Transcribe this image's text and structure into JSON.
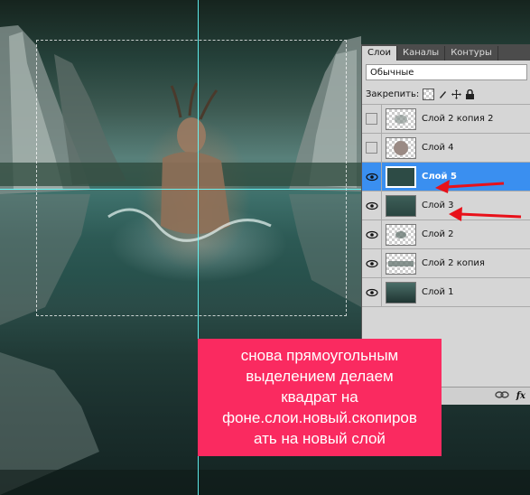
{
  "panel": {
    "tabs": [
      {
        "label": "Слои"
      },
      {
        "label": "Каналы"
      },
      {
        "label": "Контуры"
      }
    ],
    "blend_mode": "Обычные",
    "lock_label": "Закрепить:",
    "layers": [
      {
        "name": "Слой 2 копия 2",
        "visible": false,
        "selected": false
      },
      {
        "name": "Слой 4",
        "visible": false,
        "selected": false
      },
      {
        "name": "Слой 5",
        "visible": true,
        "selected": true
      },
      {
        "name": "Слой 3",
        "visible": true,
        "selected": false
      },
      {
        "name": "Слой 2",
        "visible": true,
        "selected": false
      },
      {
        "name": "Слой 2 копия",
        "visible": true,
        "selected": false
      },
      {
        "name": "Слой 1",
        "visible": true,
        "selected": false
      }
    ],
    "footer_fx": "fx"
  },
  "annotation": {
    "line1": "снова прямоугольным",
    "line2": "выделением делаем",
    "line3": "квадрат на",
    "line4": "фоне.слои.новый.скопиров",
    "line5": "ать на новый слой"
  },
  "colors": {
    "selected_layer": "#3a8ff0",
    "annotation_bg": "#fa2a60",
    "arrow": "#e8111a",
    "guide": "#66ffff"
  }
}
